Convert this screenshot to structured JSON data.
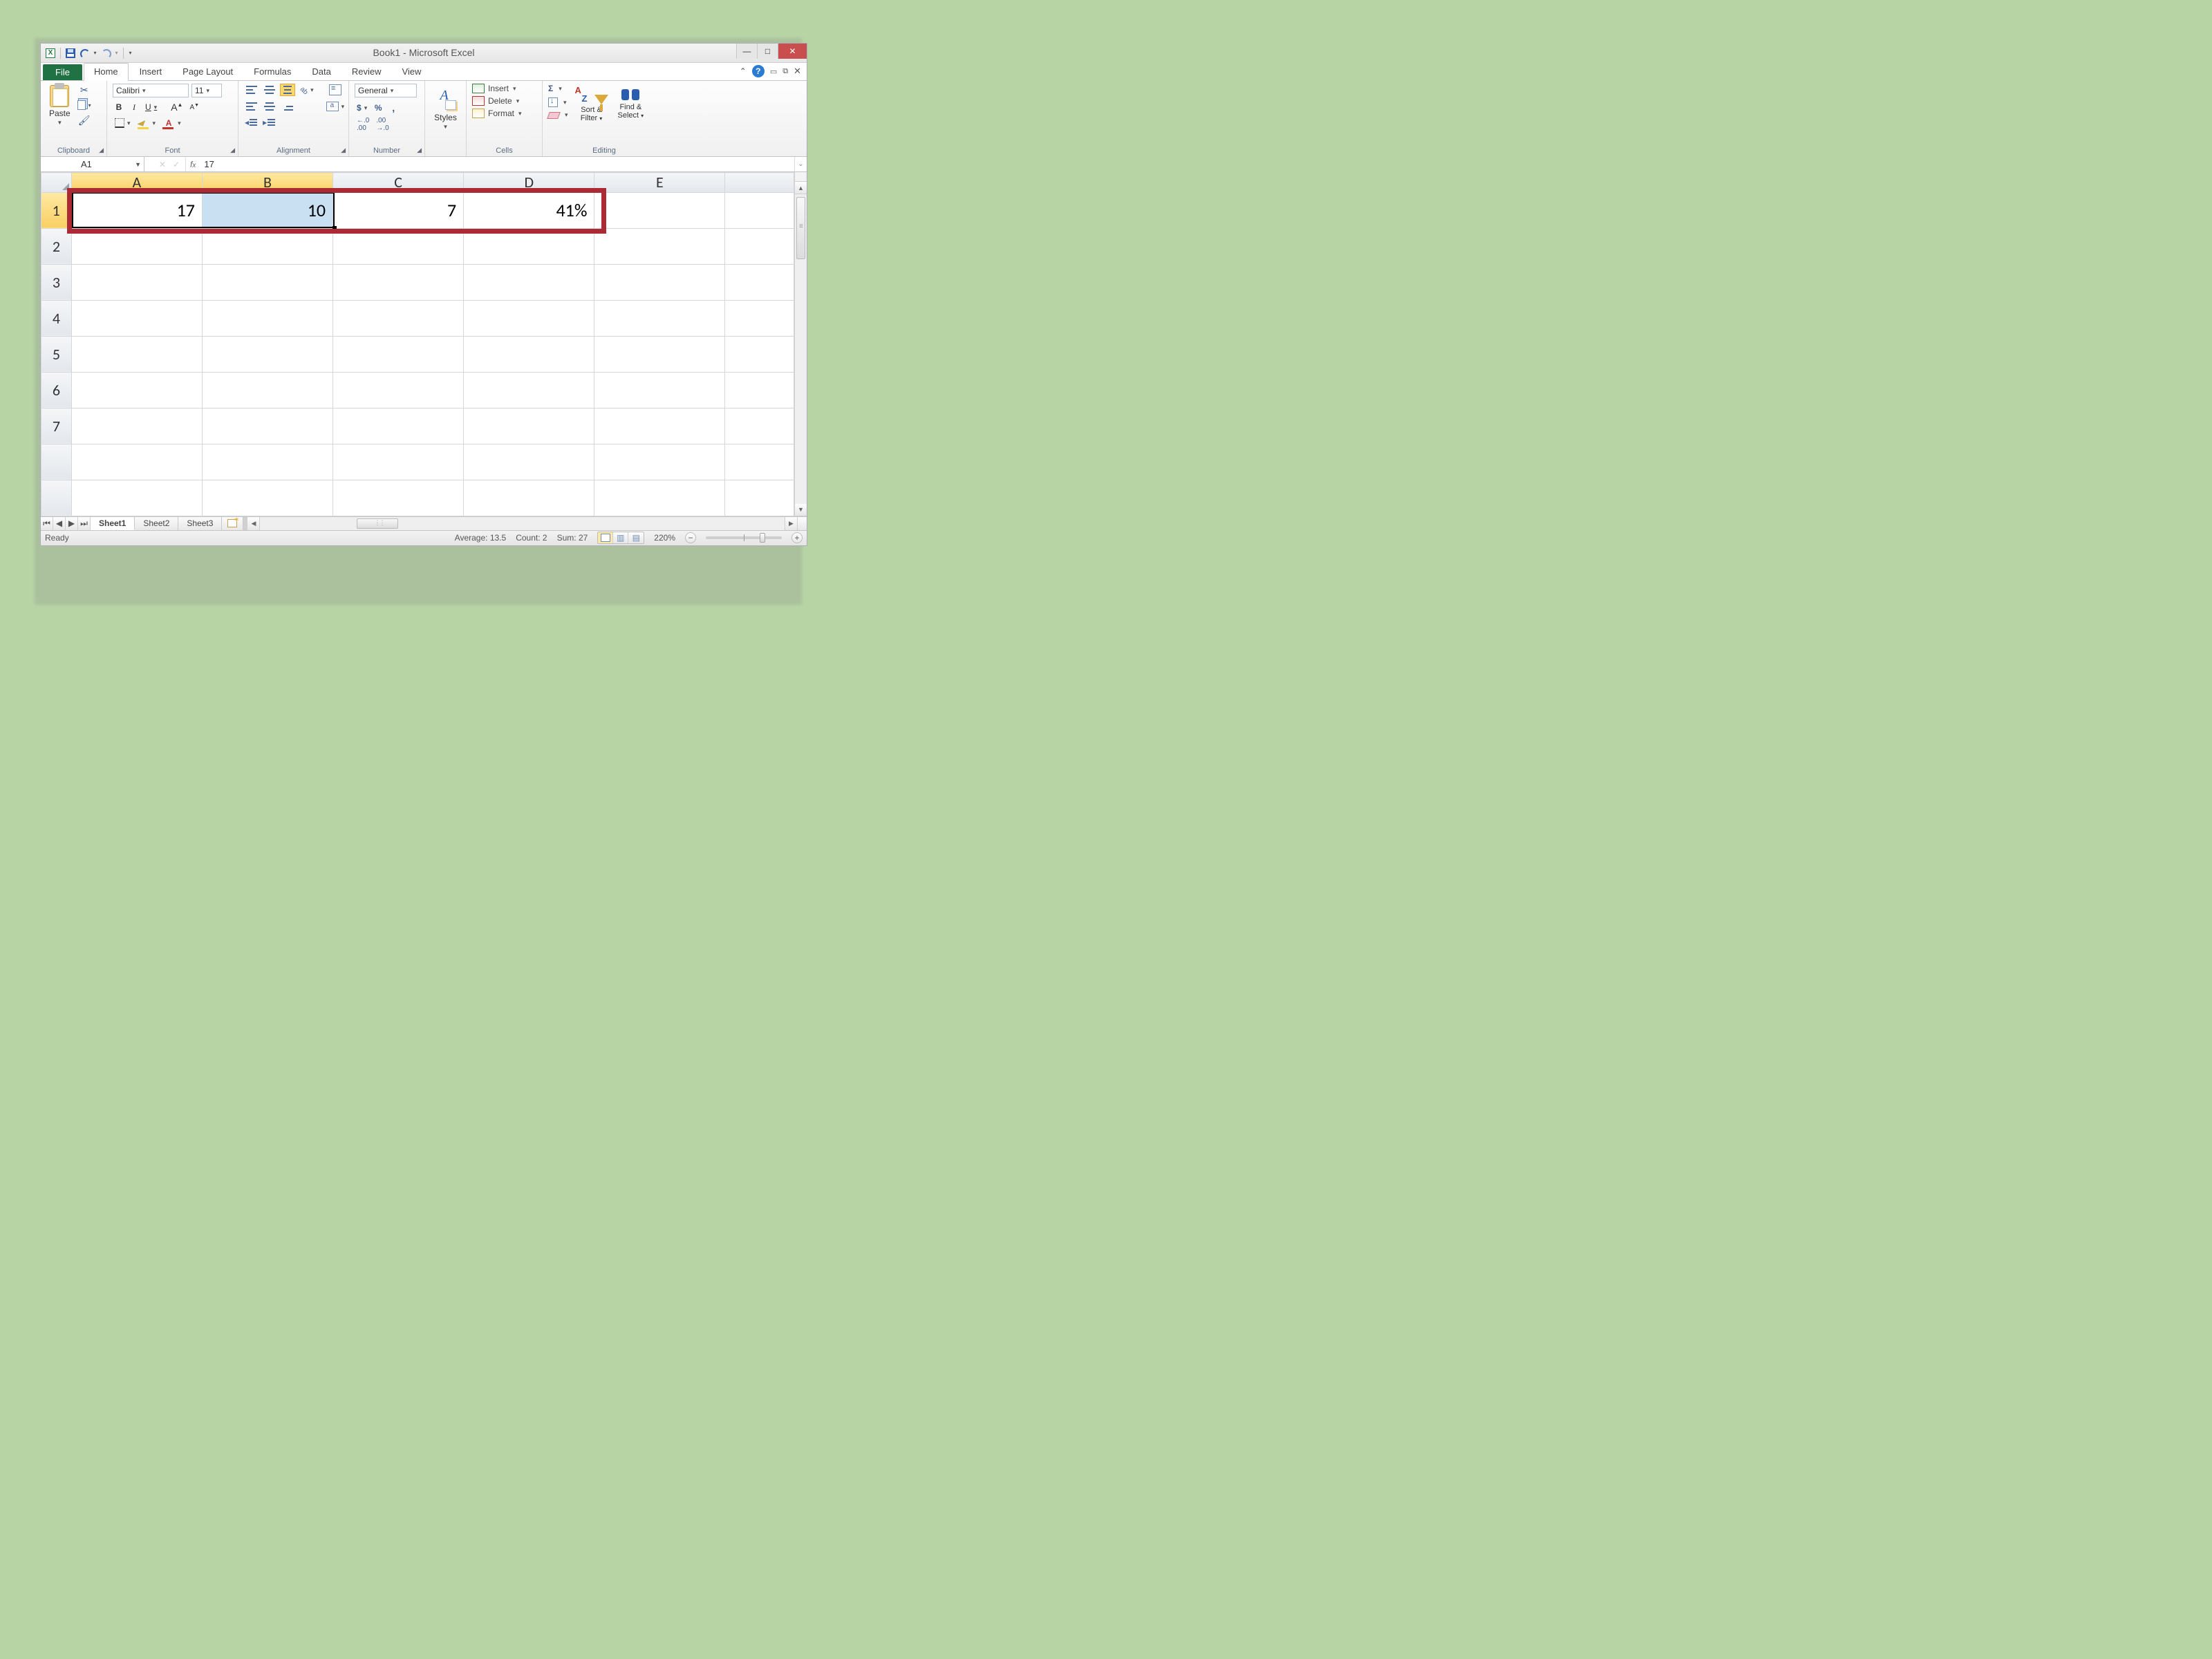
{
  "window": {
    "title": "Book1 - Microsoft Excel"
  },
  "tabs": {
    "file": "File",
    "items": [
      "Home",
      "Insert",
      "Page Layout",
      "Formulas",
      "Data",
      "Review",
      "View"
    ],
    "active": "Home"
  },
  "ribbon": {
    "clipboard": {
      "label": "Clipboard",
      "paste": "Paste"
    },
    "font": {
      "label": "Font",
      "name": "Calibri",
      "size": "11",
      "bold": "B",
      "italic": "I",
      "underline": "U",
      "fontcolor_letter": "A"
    },
    "alignment": {
      "label": "Alignment"
    },
    "number": {
      "label": "Number",
      "format": "General"
    },
    "styles": {
      "label": "Styles",
      "btn": "Styles"
    },
    "cells": {
      "label": "Cells",
      "insert": "Insert",
      "delete": "Delete",
      "format": "Format"
    },
    "editing": {
      "label": "Editing",
      "sort": "Sort &",
      "filter": "Filter",
      "find": "Find &",
      "select": "Select"
    }
  },
  "formula_bar": {
    "name_box": "A1",
    "fx": "fx",
    "value": "17"
  },
  "grid": {
    "columns": [
      "A",
      "B",
      "C",
      "D",
      "E"
    ],
    "rows": [
      "1",
      "2",
      "3",
      "4",
      "5",
      "6",
      "7"
    ],
    "data": {
      "A1": "17",
      "B1": "10",
      "C1": "7",
      "D1": "41%"
    },
    "selected_cols": [
      "A",
      "B"
    ],
    "selected_row": "1",
    "active_cell": "A1"
  },
  "sheet_tabs": {
    "items": [
      "Sheet1",
      "Sheet2",
      "Sheet3"
    ],
    "active": "Sheet1"
  },
  "status": {
    "ready": "Ready",
    "average_label": "Average:",
    "average": "13.5",
    "count_label": "Count:",
    "count": "2",
    "sum_label": "Sum:",
    "sum": "27",
    "zoom": "220%"
  }
}
